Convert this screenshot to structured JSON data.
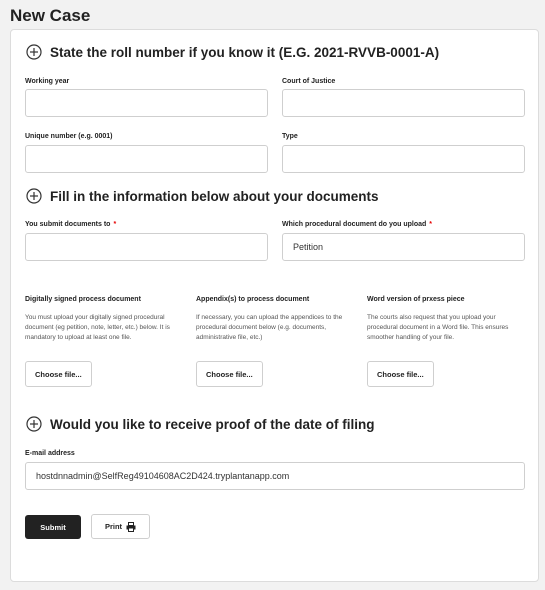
{
  "page": {
    "title": "New Case"
  },
  "roll_section": {
    "heading": "State the roll number if you know it (E.G. 2021-RVVB-0001-A)",
    "fields": {
      "working_year": {
        "label": "Working year",
        "value": ""
      },
      "court": {
        "label": "Court of Justice",
        "value": ""
      },
      "unique_number": {
        "label": "Unique number (e.g. 0001)",
        "value": ""
      },
      "type": {
        "label": "Type",
        "value": ""
      }
    }
  },
  "documents_section": {
    "heading": "Fill in the information below about your documents",
    "submit_to": {
      "label": "You submit documents to",
      "required_mark": "*",
      "value": ""
    },
    "procedural_doc": {
      "label": "Which procedural document do you upload",
      "required_mark": "*",
      "value": "Petition"
    },
    "uploads": [
      {
        "title": "Digitally signed process document",
        "description": "You must upload your digitally signed procedural document (eg petition, note, letter, etc.) below. It is mandatory to upload at least one file.",
        "button": "Choose file..."
      },
      {
        "title": "Appendix(s) to process document",
        "description": "If necessary, you can upload the appendices to the procedural document below (e.g. documents, administrative file, etc.)",
        "button": "Choose file..."
      },
      {
        "title": "Word version of prxess piece",
        "description": "The courts also request that you upload your procedural document in a Word file. This ensures smoother handling of your file.",
        "button": "Choose file..."
      }
    ]
  },
  "proof_section": {
    "heading": "Would you like to receive proof of the date of filing",
    "email": {
      "label": "E-mail address",
      "value": "hostdnnadmin@SelfReg49104608AC2D424.tryplantanapp.com"
    }
  },
  "actions": {
    "submit": "Submit",
    "print": "Print"
  },
  "icons": {
    "section": "plus-circle-icon",
    "print": "printer-icon"
  }
}
